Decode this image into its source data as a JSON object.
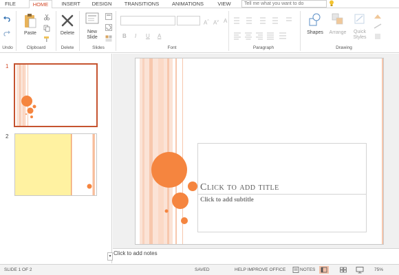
{
  "tabs": [
    {
      "label": "FILE",
      "active": false
    },
    {
      "label": "HOME",
      "active": true
    },
    {
      "label": "INSERT",
      "active": false
    },
    {
      "label": "DESIGN",
      "active": false
    },
    {
      "label": "TRANSITIONS",
      "active": false
    },
    {
      "label": "ANIMATIONS",
      "active": false
    },
    {
      "label": "VIEW",
      "active": false
    }
  ],
  "tell_me": {
    "placeholder": "Tell me what you want to do"
  },
  "ribbon": {
    "undo_group": "Undo",
    "clipboard": {
      "label": "Clipboard",
      "paste": "Paste"
    },
    "delete_group": {
      "label": "Delete",
      "delete": "Delete"
    },
    "slides": {
      "label": "Slides",
      "new_slide_line1": "New",
      "new_slide_line2": "Slide"
    },
    "font": {
      "label": "Font"
    },
    "paragraph": {
      "label": "Paragraph"
    },
    "drawing": {
      "label": "Drawing",
      "shapes": "Shapes",
      "arrange": "Arrange",
      "quick_styles_line1": "Quick",
      "quick_styles_line2": "Styles"
    }
  },
  "thumbnails": [
    {
      "number": "1",
      "selected": true
    },
    {
      "number": "2",
      "selected": false
    }
  ],
  "slide": {
    "title_placeholder": "Click to add title",
    "subtitle_placeholder": "Click to add subtitle"
  },
  "notes": {
    "placeholder": "Click to add notes"
  },
  "status": {
    "slide_info": "SLIDE 1 OF 2",
    "saved": "SAVED",
    "help": "HELP IMPROVE OFFICE",
    "notes": "NOTES",
    "zoom": "75%"
  },
  "colors": {
    "accent": "#d24726",
    "orange_circle": "#f5853f",
    "stripe_light": "#fbe3d6",
    "stripe_mid": "#f7c7ad",
    "thumb2_yellow": "#fff2a1"
  }
}
